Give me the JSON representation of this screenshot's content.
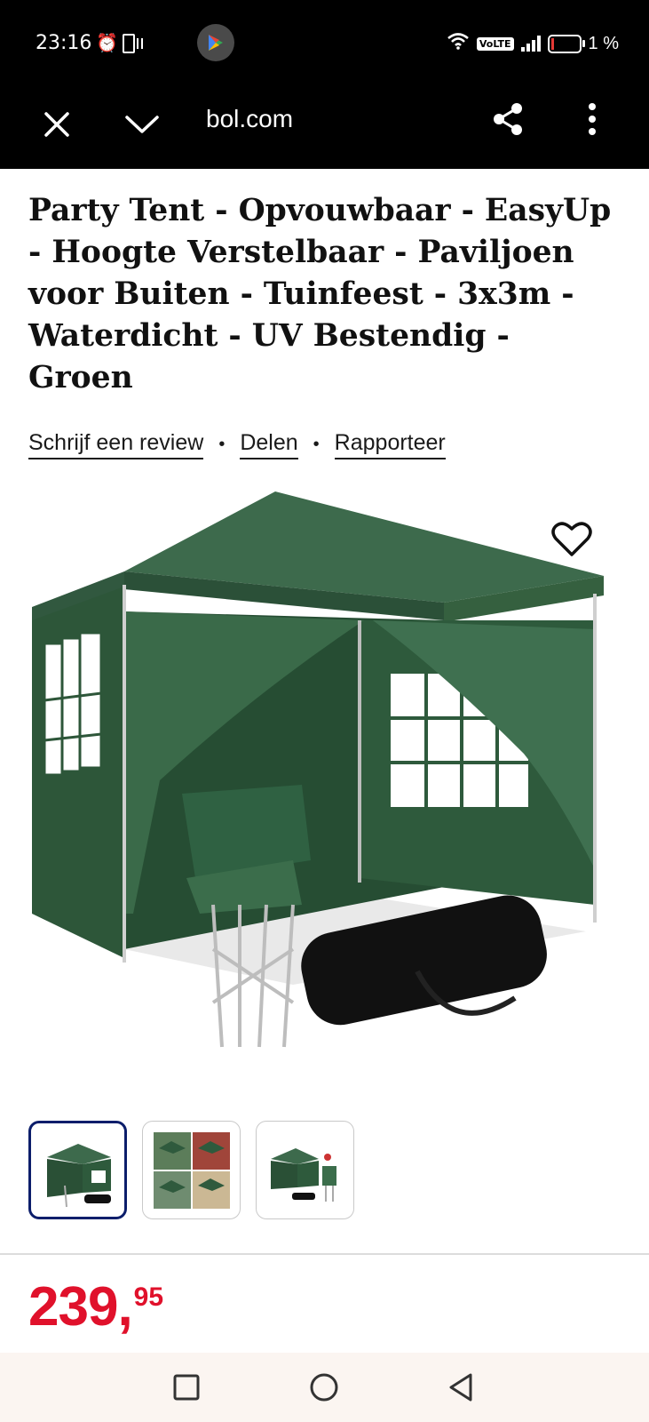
{
  "status_bar": {
    "time": "23:16",
    "battery_text": "1 %",
    "network_badge": "VoLTE",
    "wifi_label": "6"
  },
  "browser": {
    "url": "bol.com",
    "icons": [
      "close-icon",
      "chevron-down-icon",
      "share-icon",
      "more-vert-icon"
    ]
  },
  "product": {
    "title": "Party Tent - Opvouwbaar - EasyUp - Hoogte Verstelbaar - Paviljoen voor Buiten - Tuinfeest - 3x3m - Waterdicht - UV Bestendig - Groen",
    "actions": {
      "review": "Schrijf een review",
      "share": "Delen",
      "report": "Rapporteer",
      "separator": "•"
    },
    "price_whole": "239,",
    "price_fraction": "95",
    "price_color": "#e0112b",
    "tent_color": "#2f5a3d",
    "thumbnail_count": 3,
    "selected_thumbnail": 1
  },
  "nav_bar": {
    "icons": [
      "recent-apps-icon",
      "home-icon",
      "back-icon"
    ]
  }
}
